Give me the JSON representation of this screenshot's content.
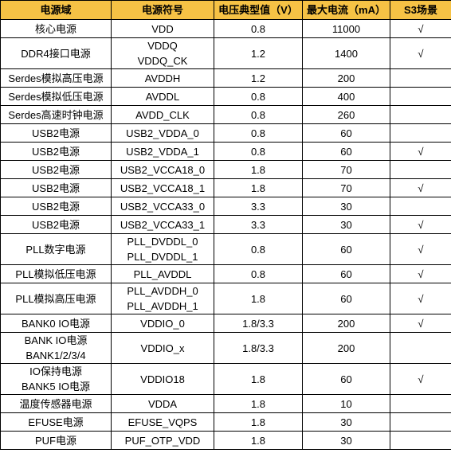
{
  "table": {
    "headers": [
      "电源域",
      "电源符号",
      "电压典型值（V）",
      "最大电流（mA）",
      "S3场景"
    ],
    "rows": [
      {
        "domain": [
          "核心电源"
        ],
        "symbol": [
          "VDD"
        ],
        "voltage": "0.8",
        "current": "11000",
        "s3": "√"
      },
      {
        "domain": [
          "DDR4接口电源"
        ],
        "symbol": [
          "VDDQ",
          "VDDQ_CK"
        ],
        "voltage": "1.2",
        "current": "1400",
        "s3": "√"
      },
      {
        "domain": [
          "Serdes模拟高压电源"
        ],
        "symbol": [
          "AVDDH"
        ],
        "voltage": "1.2",
        "current": "200",
        "s3": ""
      },
      {
        "domain": [
          "Serdes模拟低压电源"
        ],
        "symbol": [
          "AVDDL"
        ],
        "voltage": "0.8",
        "current": "400",
        "s3": ""
      },
      {
        "domain": [
          "Serdes高速时钟电源"
        ],
        "symbol": [
          "AVDD_CLK"
        ],
        "voltage": "0.8",
        "current": "260",
        "s3": ""
      },
      {
        "domain": [
          "USB2电源"
        ],
        "symbol": [
          "USB2_VDDA_0"
        ],
        "voltage": "0.8",
        "current": "60",
        "s3": ""
      },
      {
        "domain": [
          "USB2电源"
        ],
        "symbol": [
          "USB2_VDDA_1"
        ],
        "voltage": "0.8",
        "current": "60",
        "s3": "√"
      },
      {
        "domain": [
          "USB2电源"
        ],
        "symbol": [
          "USB2_VCCA18_0"
        ],
        "voltage": "1.8",
        "current": "70",
        "s3": ""
      },
      {
        "domain": [
          "USB2电源"
        ],
        "symbol": [
          "USB2_VCCA18_1"
        ],
        "voltage": "1.8",
        "current": "70",
        "s3": "√"
      },
      {
        "domain": [
          "USB2电源"
        ],
        "symbol": [
          "USB2_VCCA33_0"
        ],
        "voltage": "3.3",
        "current": "30",
        "s3": ""
      },
      {
        "domain": [
          "USB2电源"
        ],
        "symbol": [
          "USB2_VCCA33_1"
        ],
        "voltage": "3.3",
        "current": "30",
        "s3": "√"
      },
      {
        "domain": [
          "PLL数字电源"
        ],
        "symbol": [
          "PLL_DVDDL_0",
          "PLL_DVDDL_1"
        ],
        "voltage": "0.8",
        "current": "60",
        "s3": "√"
      },
      {
        "domain": [
          "PLL模拟低压电源"
        ],
        "symbol": [
          "PLL_AVDDL"
        ],
        "voltage": "0.8",
        "current": "60",
        "s3": "√"
      },
      {
        "domain": [
          "PLL模拟高压电源"
        ],
        "symbol": [
          "PLL_AVDDH_0",
          "PLL_AVDDH_1"
        ],
        "voltage": "1.8",
        "current": "60",
        "s3": "√"
      },
      {
        "domain": [
          "BANK0 IO电源"
        ],
        "symbol": [
          "VDDIO_0"
        ],
        "voltage": "1.8/3.3",
        "current": "200",
        "s3": "√"
      },
      {
        "domain": [
          "BANK IO电源",
          "BANK1/2/3/4"
        ],
        "symbol": [
          "VDDIO_x"
        ],
        "voltage": "1.8/3.3",
        "current": "200",
        "s3": ""
      },
      {
        "domain": [
          "IO保持电源",
          "BANK5 IO电源"
        ],
        "symbol": [
          "VDDIO18"
        ],
        "voltage": "1.8",
        "current": "60",
        "s3": "√"
      },
      {
        "domain": [
          "温度传感器电源"
        ],
        "symbol": [
          "VDDA"
        ],
        "voltage": "1.8",
        "current": "10",
        "s3": ""
      },
      {
        "domain": [
          "EFUSE电源"
        ],
        "symbol": [
          "EFUSE_VQPS"
        ],
        "voltage": "1.8",
        "current": "30",
        "s3": ""
      },
      {
        "domain": [
          "PUF电源"
        ],
        "symbol": [
          "PUF_OTP_VDD"
        ],
        "voltage": "1.8",
        "current": "30",
        "s3": ""
      }
    ]
  }
}
